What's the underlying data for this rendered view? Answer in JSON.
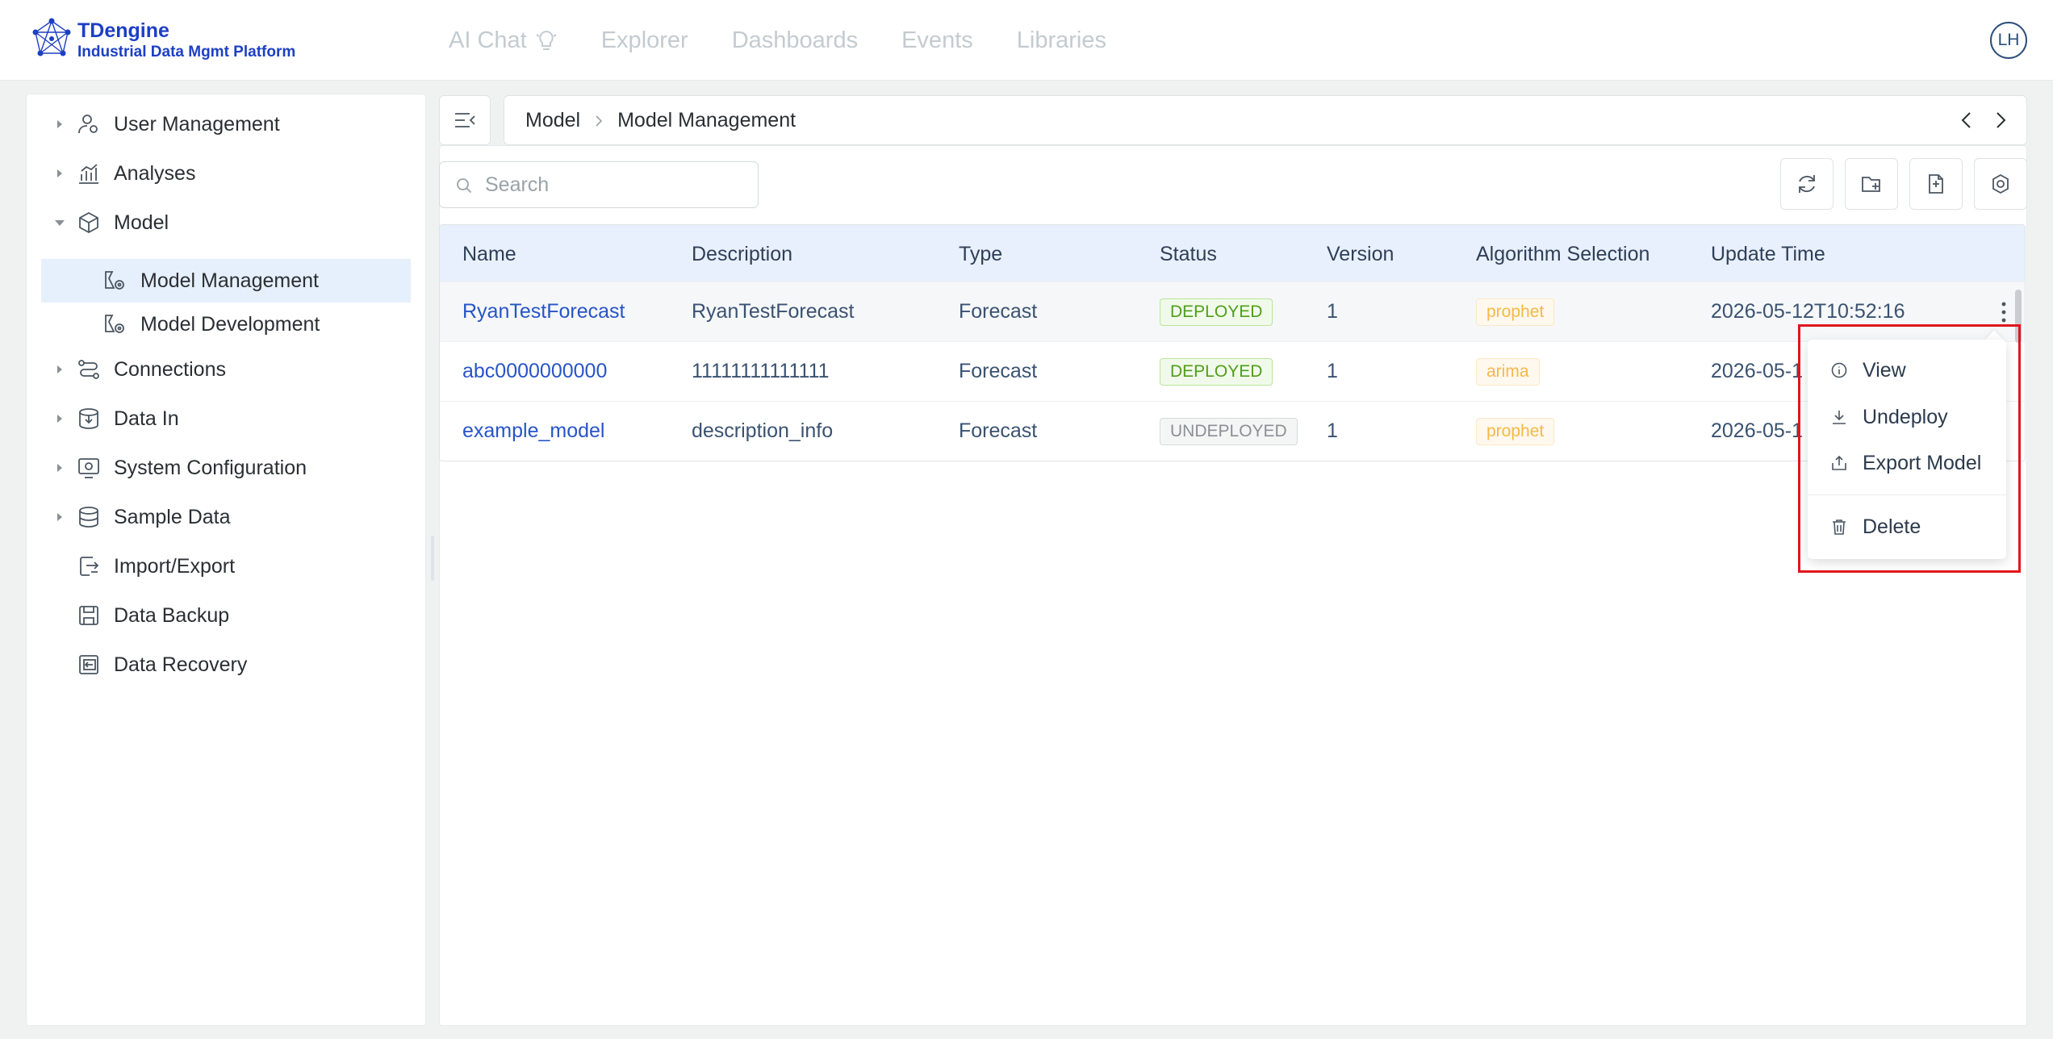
{
  "app": {
    "logo_title": "TDengine",
    "logo_subtitle": "Industrial Data Mgmt Platform",
    "brand_color": "#1d3fc4"
  },
  "topnav": {
    "items": [
      "AI Chat",
      "Explorer",
      "Dashboards",
      "Events",
      "Libraries"
    ]
  },
  "user": {
    "initials": "LH"
  },
  "sidebar": {
    "items": [
      {
        "label": "User Management",
        "icon": "user-settings-icon",
        "expandable": true
      },
      {
        "label": "Analyses",
        "icon": "analytics-chart-icon",
        "expandable": true
      },
      {
        "label": "Model",
        "icon": "cube-icon",
        "expandable": true,
        "expanded": true
      },
      {
        "label": "Model Management",
        "icon": "model-settings-icon",
        "child": true,
        "active": true
      },
      {
        "label": "Model Development",
        "icon": "model-settings-icon",
        "child": true
      },
      {
        "label": "Connections",
        "icon": "connections-icon",
        "expandable": true
      },
      {
        "label": "Data In",
        "icon": "database-in-icon",
        "expandable": true
      },
      {
        "label": "System Configuration",
        "icon": "system-config-icon",
        "expandable": true
      },
      {
        "label": "Sample Data",
        "icon": "database-icon",
        "expandable": true
      },
      {
        "label": "Import/Export",
        "icon": "import-export-icon"
      },
      {
        "label": "Data Backup",
        "icon": "backup-icon"
      },
      {
        "label": "Data Recovery",
        "icon": "recovery-icon"
      }
    ]
  },
  "breadcrumb": [
    "Model",
    "Model Management"
  ],
  "search": {
    "placeholder": "Search",
    "value": ""
  },
  "toolbar": [
    "refresh-icon",
    "add-folder-icon",
    "import-file-icon",
    "settings-gear-icon"
  ],
  "table": {
    "columns": [
      "Name",
      "Description",
      "Type",
      "Status",
      "Version",
      "Algorithm Selection",
      "Update Time"
    ],
    "rows": [
      {
        "name": "RyanTestForecast",
        "description": "RyanTestForecast",
        "type": "Forecast",
        "status": "DEPLOYED",
        "version": "1",
        "algorithm": "prophet",
        "update_time": "2026-05-12T10:52:16"
      },
      {
        "name": "abc0000000000",
        "description": "11111111111111",
        "type": "Forecast",
        "status": "DEPLOYED",
        "version": "1",
        "algorithm": "arima",
        "update_time": "2026-05-1"
      },
      {
        "name": "example_model",
        "description": "description_info",
        "type": "Forecast",
        "status": "UNDEPLOYED",
        "version": "1",
        "algorithm": "prophet",
        "update_time": "2026-05-1"
      }
    ]
  },
  "dropdown": {
    "items": [
      {
        "label": "View",
        "icon": "info-icon"
      },
      {
        "label": "Undeploy",
        "icon": "download-icon"
      },
      {
        "label": "Export Model",
        "icon": "export-icon"
      },
      {
        "label": "Delete",
        "icon": "trash-icon"
      }
    ]
  },
  "colors": {
    "link": "#2754c8",
    "deployed": "#4f9e1a",
    "undeployed": "#8a9095",
    "algorithm_tag": "#f5b945",
    "highlight": "#e0161c",
    "header_bg": "#e8f0fd"
  }
}
